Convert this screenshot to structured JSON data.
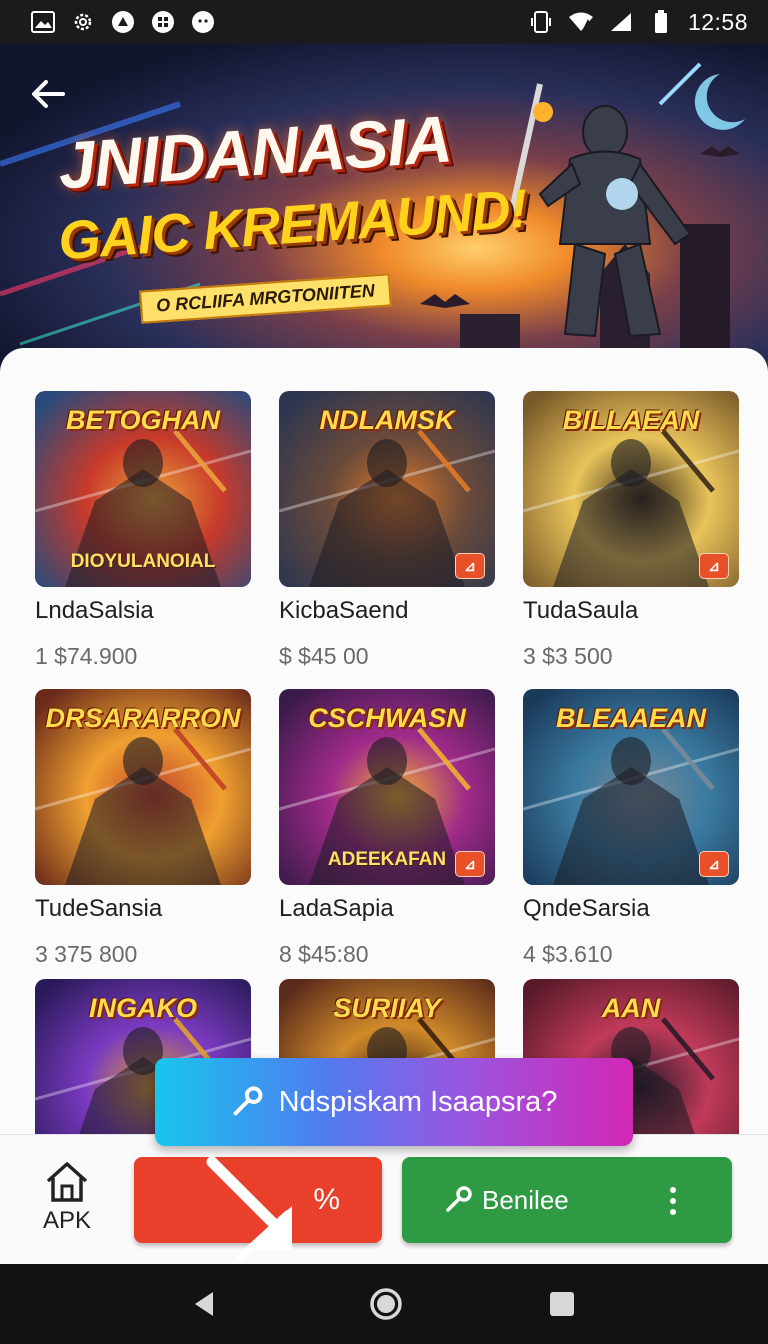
{
  "status_bar": {
    "left_icons": [
      "image-icon",
      "settings-gear-icon",
      "vpn-icon",
      "app-grid-icon",
      "face-icon"
    ],
    "right_icons": [
      "vibrate-icon",
      "wifi-icon",
      "signal-icon",
      "battery-icon"
    ],
    "time": "12:58"
  },
  "hero": {
    "title_line1": "JNIDANASIA",
    "title_line2": "GAIC KREMAUND!",
    "ribbon": "O RCLIIFA MRGTONIITEN"
  },
  "games": [
    {
      "thumb_title": "BETOGHAN",
      "thumb_sub": "DIOYULANOIAL",
      "name": "LndaSalsia",
      "price": "1 $74.900",
      "badge": false,
      "colors": [
        "#2a4a7a",
        "#c83a2a",
        "#e9a13b"
      ]
    },
    {
      "thumb_title": "NDLAMSK",
      "thumb_sub": "",
      "name": "KicbaSaend",
      "price": "$ $45 00",
      "badge": true,
      "colors": [
        "#2b3550",
        "#6a4a3a",
        "#e07a2a"
      ]
    },
    {
      "thumb_title": "BILLAEAN",
      "thumb_sub": "",
      "name": "TudaSaula",
      "price": "3 $3 500",
      "badge": true,
      "colors": [
        "#7a5a2a",
        "#e8c45a",
        "#3a2a1a"
      ]
    },
    {
      "thumb_title": "DRSARARRON",
      "thumb_sub": "",
      "name": "TudeSansia",
      "price": "3 375 800",
      "badge": false,
      "colors": [
        "#6a2a1a",
        "#f0a030",
        "#c0402a"
      ]
    },
    {
      "thumb_title": "CSCHWASN",
      "thumb_sub": "ADEEKAFAN",
      "name": "LadaSapia",
      "price": "8 $45:80",
      "badge": true,
      "colors": [
        "#3a1a4a",
        "#a02a8a",
        "#f0b030"
      ]
    },
    {
      "thumb_title": "BLEAAEAN",
      "thumb_sub": "",
      "name": "QndeSarsia",
      "price": "4 $3.610",
      "badge": true,
      "colors": [
        "#1a3a5a",
        "#3a7aa0",
        "#7a8a9a"
      ]
    },
    {
      "thumb_title": "INGAKO",
      "thumb_sub": "",
      "name": "",
      "price": "",
      "badge": false,
      "colors": [
        "#2a1a5a",
        "#7a3ac0",
        "#e0a030"
      ]
    },
    {
      "thumb_title": "SURIIAY",
      "thumb_sub": "",
      "name": "",
      "price": "",
      "badge": false,
      "colors": [
        "#5a2a1a",
        "#d08a2a",
        "#3a2010"
      ]
    },
    {
      "thumb_title": "AAN",
      "thumb_sub": "",
      "name": "",
      "price": "",
      "badge": true,
      "colors": [
        "#5a1a2a",
        "#c03a5a",
        "#2a1a2a"
      ]
    }
  ],
  "promo": {
    "label": "Ndspiskam Isaapsra?",
    "icon": "key-icon"
  },
  "bottom": {
    "apk_label": "APK",
    "red_button": "%",
    "green_button": "Benilee",
    "green_icon": "key-icon"
  },
  "nav": {
    "back": "back-triangle-icon",
    "home": "home-circle-icon",
    "recents": "recents-square-icon"
  }
}
